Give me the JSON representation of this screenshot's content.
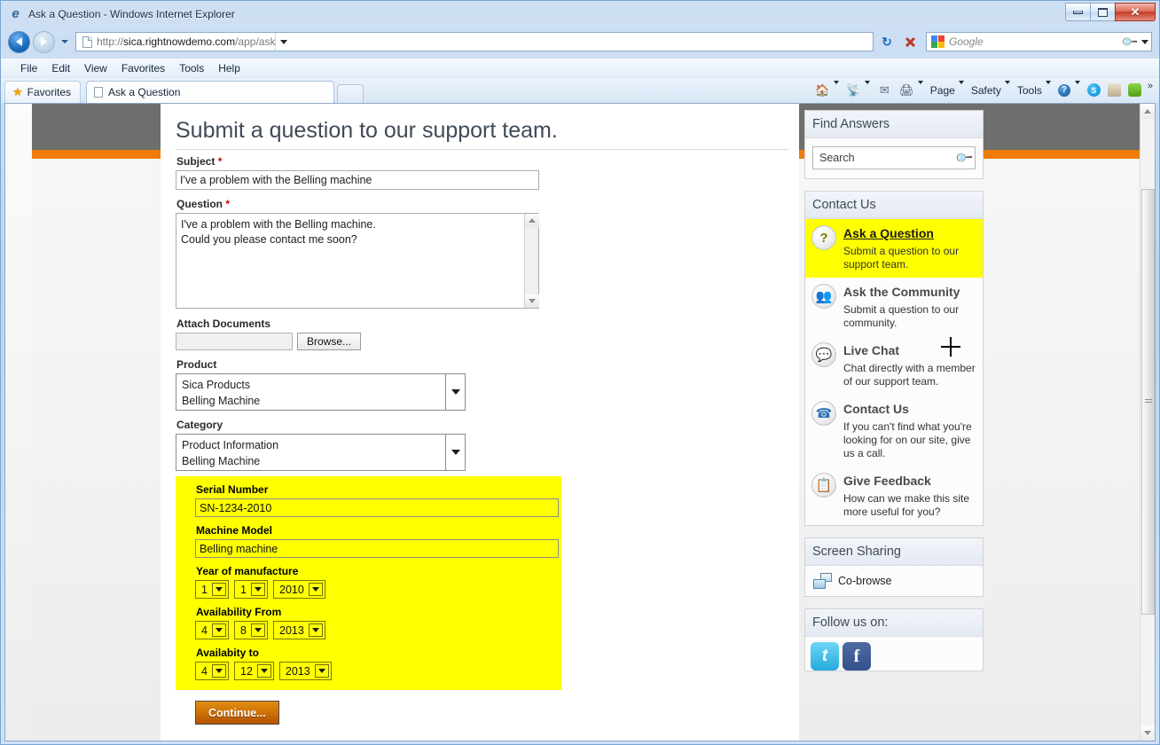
{
  "window": {
    "title": "Ask a Question - Windows Internet Explorer",
    "icon": "ie-icon",
    "buttons": {
      "minimize": "minimize",
      "maximize": "restore",
      "close": "close"
    }
  },
  "browser": {
    "url": {
      "scheme": "http://",
      "domain": "sica.rightnowdemo.com",
      "path": "/app/ask"
    },
    "url_full": "http://sica.rightnowdemo.com/app/ask",
    "nav": {
      "back": "back-button",
      "forward": "forward-button",
      "history": "history-dropdown"
    },
    "address_actions": {
      "dropdown": "address-dropdown",
      "refresh": "refresh-button",
      "stop": "stop-button"
    },
    "search": {
      "provider": "Google",
      "placeholder": "Google",
      "value": ""
    },
    "menu": [
      "File",
      "Edit",
      "View",
      "Favorites",
      "Tools",
      "Help"
    ],
    "favorites_label": "Favorites",
    "tab": {
      "label": "Ask a Question"
    },
    "command_bar": [
      {
        "label": "",
        "icon": "home-icon",
        "caret": true
      },
      {
        "label": "",
        "icon": "rss-feed-icon",
        "caret": true
      },
      {
        "label": "",
        "icon": "mail-icon",
        "caret": false
      },
      {
        "label": "",
        "icon": "print-icon",
        "caret": true
      },
      {
        "label": "Page",
        "icon": "",
        "caret": true
      },
      {
        "label": "Safety",
        "icon": "",
        "caret": true
      },
      {
        "label": "Tools",
        "icon": "",
        "caret": true
      },
      {
        "label": "",
        "icon": "help-icon",
        "caret": true
      },
      {
        "label": "",
        "icon": "skype-icon",
        "caret": false
      },
      {
        "label": "",
        "icon": "addon-icon",
        "caret": false
      },
      {
        "label": "",
        "icon": "evernote-icon",
        "caret": false
      }
    ],
    "overflow": "»"
  },
  "page": {
    "title": "Submit a question to our support team.",
    "form": {
      "subject": {
        "label": "Subject",
        "required": true,
        "value": "I've a problem with the Belling machine"
      },
      "question": {
        "label": "Question",
        "required": true,
        "value": "I've a problem with the Belling machine.\nCould you please contact me soon?"
      },
      "attach": {
        "label": "Attach Documents",
        "value": "",
        "button": "Browse..."
      },
      "product": {
        "label": "Product",
        "line1": "Sica Products",
        "line2": "Belling Machine"
      },
      "category": {
        "label": "Category",
        "line1": "Product Information",
        "line2": "Belling Machine"
      },
      "serial_number": {
        "label": "Serial Number",
        "value": "SN-1234-2010"
      },
      "machine_model": {
        "label": "Machine Model",
        "value": "Belling machine"
      },
      "year_of_manufacture": {
        "label": "Year of manufacture",
        "day": "1",
        "month": "1",
        "year": "2010"
      },
      "availability_from": {
        "label": "Availability From",
        "day": "4",
        "month": "8",
        "year": "2013"
      },
      "availability_to": {
        "label": "Availabity to",
        "day": "4",
        "month": "12",
        "year": "2013"
      },
      "submit": "Continue..."
    }
  },
  "sidebar": {
    "find_answers": {
      "title": "Find Answers",
      "search_placeholder": "Search",
      "search_value": ""
    },
    "contact_us": {
      "title": "Contact Us",
      "items": [
        {
          "title": "Ask a Question",
          "desc": "Submit a question to our support team.",
          "icon": "question-mark-icon",
          "highlighted": true
        },
        {
          "title": "Ask the Community",
          "desc": "Submit a question to our community.",
          "icon": "community-people-icon",
          "highlighted": false
        },
        {
          "title": "Live Chat",
          "desc": "Chat directly with a member of our support team.",
          "icon": "chat-bubble-icon",
          "highlighted": false
        },
        {
          "title": "Contact Us",
          "desc": "If you can't find what you're looking for on our site, give us a call.",
          "icon": "phone-icon",
          "highlighted": false
        },
        {
          "title": "Give Feedback",
          "desc": "How can we make this site more useful for you?",
          "icon": "clipboard-icon",
          "highlighted": false
        }
      ]
    },
    "screen_sharing": {
      "title": "Screen Sharing",
      "item": "Co-browse",
      "icon": "co-browse-icon"
    },
    "follow_us": {
      "title": "Follow us on:",
      "links": [
        "twitter-icon",
        "facebook-icon"
      ]
    }
  },
  "theme": {
    "banner_gray": "#6e6e6e",
    "banner_orange": "#ef7c08",
    "highlight_yellow": "#ffff00",
    "button_orange": "#d07406",
    "required_red": "#cc0000"
  }
}
